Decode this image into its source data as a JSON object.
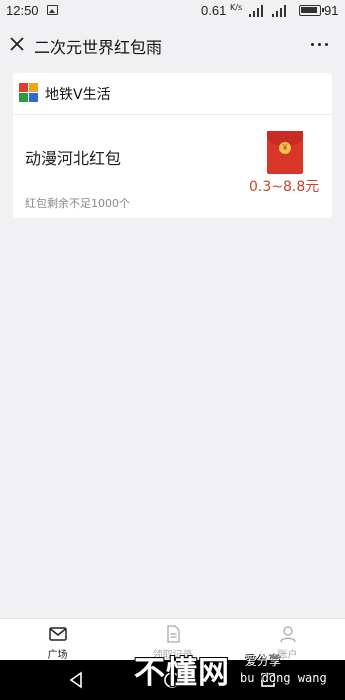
{
  "status_bar": {
    "time": "12:50",
    "network_speed": "0.61",
    "network_unit": "K/s",
    "battery": "91",
    "icons": [
      "image-icon",
      "signal-icon",
      "signal-icon",
      "battery-icon"
    ]
  },
  "title_bar": {
    "title": "二次元世界红包雨",
    "close_icon": "close-icon",
    "more_icon": "more-icon"
  },
  "card": {
    "account_name": "地铁V生活",
    "red_packet_title": "动漫河北红包",
    "amount_range": "0.3~8.8元",
    "remaining_text": "红包剩余不足1000个",
    "envelope_coin": "¥",
    "accent_color": "#d9362a",
    "amount_color": "#c9452b"
  },
  "tabs": [
    {
      "label": "广场",
      "icon": "mail-icon",
      "active": true
    },
    {
      "label": "领取记录",
      "icon": "document-icon",
      "active": false
    },
    {
      "label": "账户",
      "icon": "user-icon",
      "active": false
    }
  ],
  "nav_bar": {
    "icons": [
      "back-icon",
      "home-icon",
      "recents-icon"
    ]
  },
  "watermark": {
    "main": "不懂网",
    "sub": "爱分享",
    "pinyin": "bu dong wang"
  }
}
